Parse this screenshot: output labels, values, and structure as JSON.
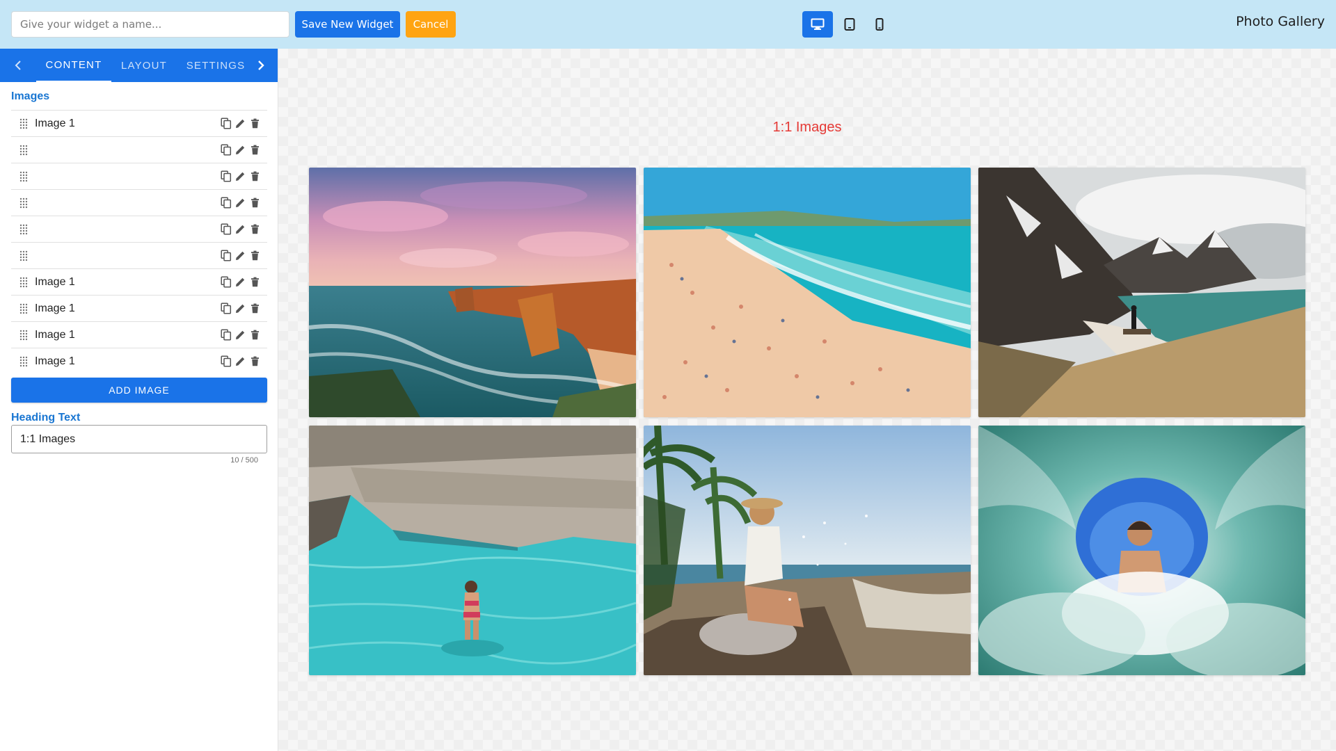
{
  "toolbar": {
    "name_placeholder": "Give your widget a name...",
    "save_label": "Save New Widget",
    "cancel_label": "Cancel",
    "devices": [
      "desktop-icon",
      "tablet-icon",
      "phone-icon"
    ],
    "active_device": "desktop",
    "app_title": "Photo Gallery"
  },
  "sidebar": {
    "tabs": [
      {
        "label": "CONTENT",
        "active": true
      },
      {
        "label": "LAYOUT",
        "active": false
      },
      {
        "label": "SETTINGS",
        "active": false
      }
    ],
    "images_label": "Images",
    "image_items": [
      {
        "label": "Image 1"
      },
      {
        "label": ""
      },
      {
        "label": ""
      },
      {
        "label": ""
      },
      {
        "label": ""
      },
      {
        "label": ""
      },
      {
        "label": "Image 1"
      },
      {
        "label": "Image 1"
      },
      {
        "label": "Image 1"
      },
      {
        "label": "Image 1"
      }
    ],
    "row_action_icons": [
      "copy-icon",
      "edit-icon",
      "delete-icon"
    ],
    "add_image_label": "ADD IMAGE",
    "heading_label": "Heading Text",
    "heading_value": "1:1 Images",
    "heading_counter": "10 / 500"
  },
  "canvas": {
    "heading": "1:1 Images",
    "photos": [
      {
        "scene": "sea-stacks-sunset"
      },
      {
        "scene": "crowded-beach"
      },
      {
        "scene": "mountain-cove-hiker"
      },
      {
        "scene": "turquoise-pool-swimmer"
      },
      {
        "scene": "beach-splash-woman"
      },
      {
        "scene": "underwater-wave-tunnel"
      }
    ]
  },
  "colors": {
    "topbar": "#c5e6f6",
    "primary": "#1a73e8",
    "cancel": "#ffa412",
    "section_label": "#1976d2",
    "gallery_heading": "#e53935"
  }
}
